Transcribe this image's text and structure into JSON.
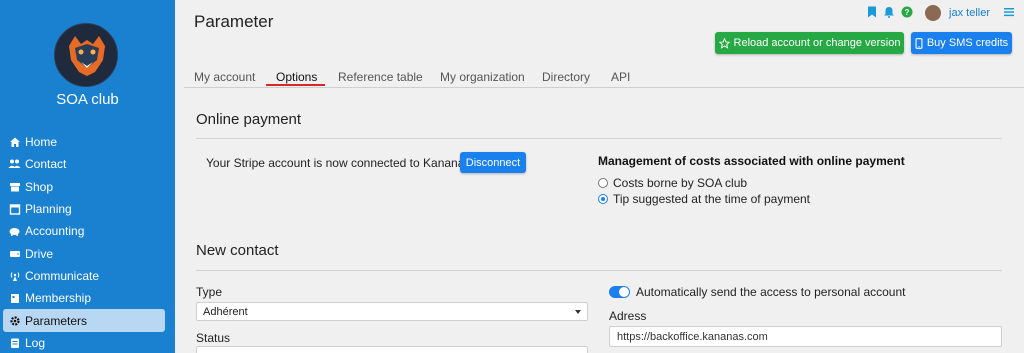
{
  "club": {
    "name": "SOA club"
  },
  "sidebar": {
    "items": [
      {
        "label": "Home",
        "icon": "home-icon"
      },
      {
        "label": "Contact",
        "icon": "users-icon"
      },
      {
        "label": "Shop",
        "icon": "shop-icon"
      },
      {
        "label": "Planning",
        "icon": "calendar-icon"
      },
      {
        "label": "Accounting",
        "icon": "piggy-bank-icon"
      },
      {
        "label": "Drive",
        "icon": "drive-icon"
      },
      {
        "label": "Communicate",
        "icon": "broadcast-icon"
      },
      {
        "label": "Membership",
        "icon": "membership-icon"
      },
      {
        "label": "Parameters",
        "icon": "gear-icon",
        "active": true
      },
      {
        "label": "Log",
        "icon": "log-icon"
      }
    ]
  },
  "header": {
    "title": "Parameter",
    "user": "jax teller",
    "reload_label": "Reload account or change version",
    "sms_label": "Buy SMS credits"
  },
  "tabs": [
    {
      "label": "My account"
    },
    {
      "label": "Options",
      "active": true
    },
    {
      "label": "Reference table"
    },
    {
      "label": "My organization"
    },
    {
      "label": "Directory"
    },
    {
      "label": "API"
    }
  ],
  "online_payment": {
    "title": "Online payment",
    "stripe_text": "Your Stripe account is now connected to Kananas",
    "disconnect_label": "Disconnect",
    "management_title": "Management of costs associated with online payment",
    "options": [
      {
        "label": "Costs borne by SOA club",
        "checked": false
      },
      {
        "label": "Tip suggested at the time of payment",
        "checked": true
      }
    ]
  },
  "new_contact": {
    "title": "New contact",
    "type_label": "Type",
    "type_value": "Adhérent",
    "status_label": "Status",
    "auto_send_label": "Automatically send the access to personal account",
    "auto_send_enabled": true,
    "address_label": "Adress",
    "address_value": "https://backoffice.kananas.com"
  },
  "colors": {
    "sidebar": "#1a80d0",
    "active_nav": "#b8d7f3",
    "green_button": "#26a944",
    "blue_button": "#1a80ee",
    "tab_underline": "#d9262c"
  }
}
